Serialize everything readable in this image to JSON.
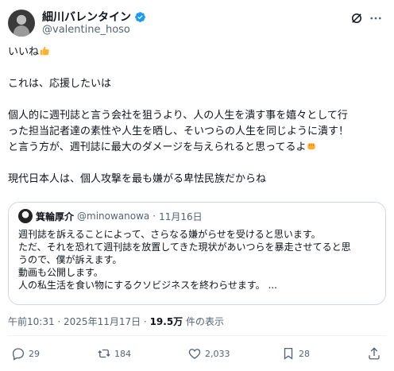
{
  "author": {
    "display_name": "細川バレンタイン",
    "handle": "@valentine_hoso"
  },
  "post": {
    "line1": "いいね",
    "line2": "これは、応援したいは",
    "para1": [
      "個人的に週刊誌と言う会社を狙うより、人の人生を潰す事を嬉々として行",
      "った担当記者達の素性や人生を晒し、そいつらの人生を同じように潰す！",
      "と言う方が、週刊誌に最大のダメージを与えられると思ってるよ"
    ],
    "para2": "現代日本人は、個人攻撃を最も嫌がる卑怯民族だからね"
  },
  "quote": {
    "display_name": "箕輪厚介",
    "handle": "@minowanowa",
    "separator": "·",
    "date": "11月16日",
    "lines": [
      "週刊誌を訴えることによって、さらなる嫌がらせを受けると思います。",
      "ただ、それを恐れて週刊誌を放置してきた現状があいつらを暴走させてると思",
      "うので、僕が訴えます。",
      "動画も公開します。",
      "人の私生活を食い物にするクソビジネスを終わらせます。 ..."
    ]
  },
  "meta": {
    "timestamp": "午前10:31 · 2025年11月17日 · ",
    "views_count": "19.5万",
    "views_label": " 件の表示"
  },
  "actions": {
    "replies": "29",
    "reposts": "184",
    "likes": "2,033",
    "bookmarks": "28"
  },
  "colors": {
    "verified": "#1d9bf0",
    "secondary_text": "#536471",
    "border": "#cfd9de"
  },
  "icons": [
    "verified-badge-icon",
    "grok-icon",
    "more-icon",
    "thumbs-up-emoji",
    "fist-emoji",
    "reply-icon",
    "repost-icon",
    "like-icon",
    "bookmark-icon",
    "share-icon"
  ]
}
